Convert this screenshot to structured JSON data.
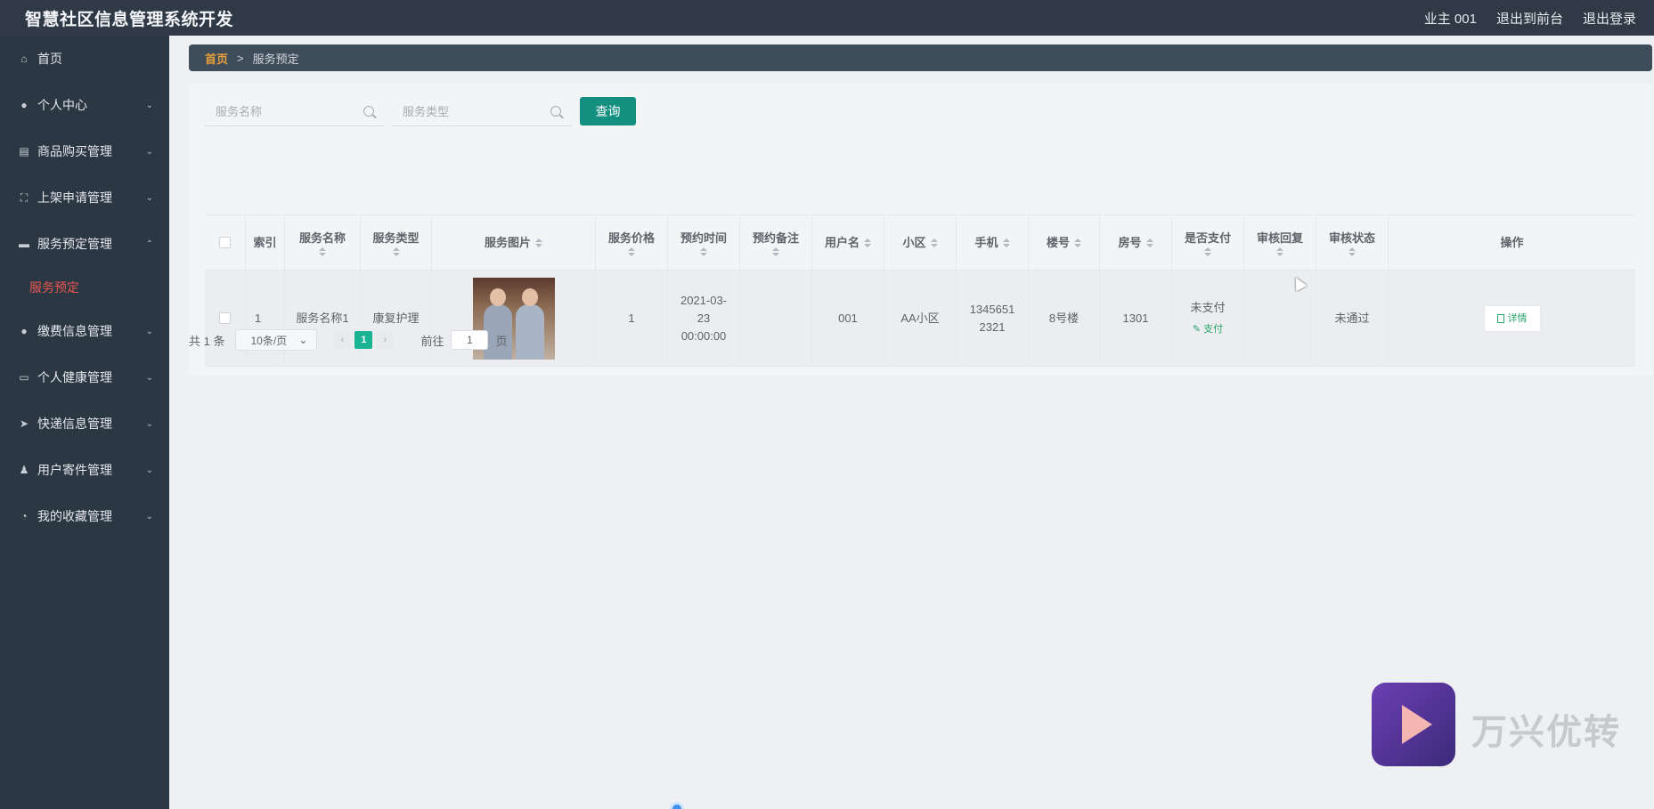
{
  "header": {
    "title": "智慧社区信息管理系统开发",
    "user": "业主 001",
    "frontend_link": "退出到前台",
    "logout_link": "退出登录"
  },
  "sidebar": {
    "items": [
      {
        "label": "首页",
        "icon": "home-icon",
        "has_children": false
      },
      {
        "label": "个人中心",
        "icon": "user-icon",
        "has_children": true
      },
      {
        "label": "商品购买管理",
        "icon": "clipboard-icon",
        "has_children": true
      },
      {
        "label": "上架申请管理",
        "icon": "fullscreen-icon",
        "has_children": true
      },
      {
        "label": "服务预定管理",
        "icon": "folder-icon",
        "has_children": true,
        "expanded": true
      },
      {
        "label": "缴费信息管理",
        "icon": "user-icon",
        "has_children": true
      },
      {
        "label": "个人健康管理",
        "icon": "chat-icon",
        "has_children": true
      },
      {
        "label": "快递信息管理",
        "icon": "send-icon",
        "has_children": true
      },
      {
        "label": "用户寄件管理",
        "icon": "stamp-icon",
        "has_children": true
      },
      {
        "label": "我的收藏管理",
        "icon": "gauge-icon",
        "has_children": true
      }
    ],
    "active_sub": "服务预定"
  },
  "breadcrumb": {
    "home": "首页",
    "separator": ">",
    "current": "服务预定"
  },
  "search": {
    "name_placeholder": "服务名称",
    "type_placeholder": "服务类型",
    "query_label": "查询"
  },
  "table": {
    "headers": {
      "index": "索引",
      "name": "服务名称",
      "type": "服务类型",
      "image": "服务图片",
      "price": "服务价格",
      "time": "预约时间",
      "note": "预约备注",
      "username": "用户名",
      "district": "小区",
      "phone": "手机",
      "building": "楼号",
      "room": "房号",
      "paid": "是否支付",
      "reply": "审核回复",
      "status": "审核状态",
      "action": "操作"
    },
    "rows": [
      {
        "index": "1",
        "name": "服务名称1",
        "type": "康复护理",
        "price": "1",
        "time": "2021-03-23 00:00:00",
        "note": "",
        "username": "001",
        "district": "AA小区",
        "phone": "13456512321",
        "building": "8号楼",
        "room": "1301",
        "paid": "未支付",
        "pay_label": "支付",
        "reply": "",
        "status": "未通过",
        "detail_label": "详情"
      }
    ]
  },
  "pagination": {
    "total": "共 1 条",
    "page_size": "10条/页",
    "current_page": "1",
    "goto_label": "前往",
    "goto_value": "1",
    "page_suffix": "页"
  },
  "watermark": {
    "text": "万兴优转"
  },
  "colors": {
    "accent": "#149080",
    "active_menu": "#e8564f",
    "topbar": "#2f3a46",
    "sidebar": "#2c3744"
  }
}
